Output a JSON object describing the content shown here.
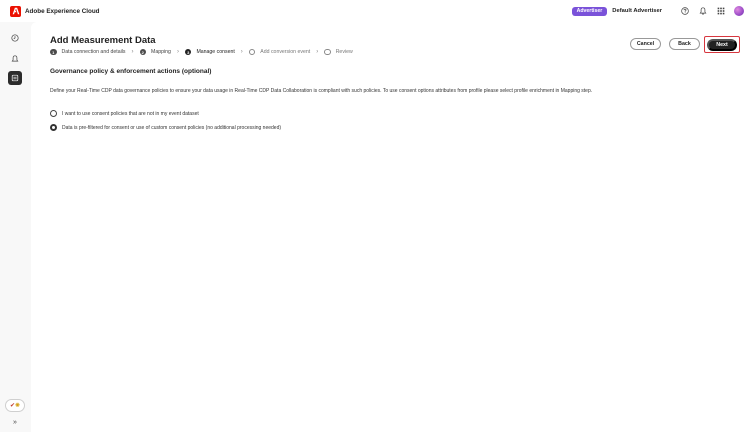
{
  "topbar": {
    "brand": "Adobe Experience Cloud",
    "role_badge": "Advertiser",
    "account_name": "Default Advertiser"
  },
  "page": {
    "title": "Add Measurement Data"
  },
  "steps": [
    {
      "number": "1",
      "label": "Data connection and details",
      "state": "complete"
    },
    {
      "number": "2",
      "label": "Mapping",
      "state": "complete"
    },
    {
      "number": "3",
      "label": "Manage consent",
      "state": "current"
    },
    {
      "number": "",
      "label": "Add conversion event",
      "state": "future"
    },
    {
      "number": "",
      "label": "Review",
      "state": "future"
    }
  ],
  "actions": {
    "cancel": "Cancel",
    "back": "Back",
    "next": "Next"
  },
  "section": {
    "title": "Governance policy & enforcement actions (optional)",
    "description": "Define your Real-Time CDP data governance policies to ensure your data usage in Real-Time CDP Data Collaboration is compliant with such policies. To use consent options attributes from profile please select profile enrichment in Mapping step."
  },
  "consent_options": [
    {
      "label": "I want to use consent policies that are not in my event dataset",
      "selected": false
    },
    {
      "label": "Data is pre-filtered for consent or use of custom consent policies (no additional processing needed)",
      "selected": true
    }
  ],
  "colors": {
    "accent_badge": "#7a52d9",
    "primary_button": "#222222",
    "highlight_border": "#d7373f",
    "adobe_red": "#eb1000"
  }
}
